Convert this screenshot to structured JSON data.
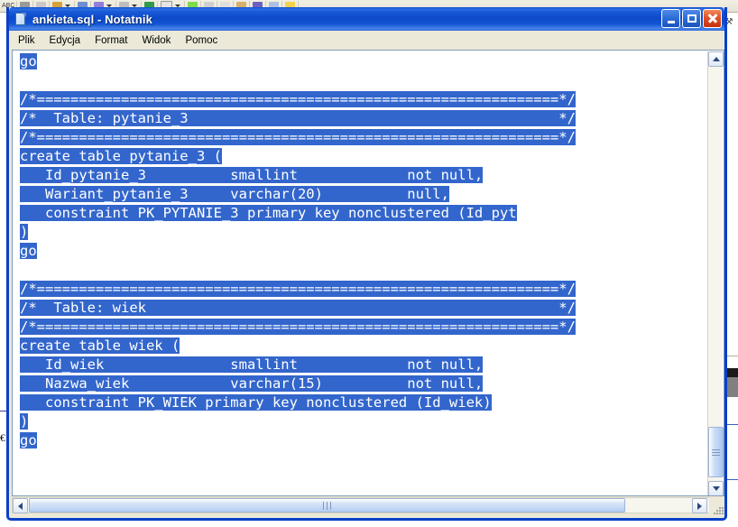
{
  "window": {
    "title": "ankieta.sql - Notatnik",
    "icon": "notepad-document-icon",
    "controls": {
      "minimize": "Minimalizuj",
      "maximize": "Maksymalizuj",
      "close": "Zamknij"
    }
  },
  "menu": {
    "items": [
      {
        "label": "Plik"
      },
      {
        "label": "Edycja"
      },
      {
        "label": "Format"
      },
      {
        "label": "Widok"
      },
      {
        "label": "Pomoc"
      }
    ]
  },
  "editor": {
    "selection_color": "#3366cc",
    "selection_text_color": "#ffffff",
    "background_color": "#ffffff",
    "lines": [
      {
        "text": "go",
        "selected": true
      },
      {
        "text": "",
        "selected": false
      },
      {
        "text": "/*==============================================================*/",
        "selected": true
      },
      {
        "text": "/*  Table: pytanie_3                                            */",
        "selected": true
      },
      {
        "text": "/*==============================================================*/",
        "selected": true
      },
      {
        "text": "create table pytanie_3 (",
        "selected": true
      },
      {
        "text": "   Id_pytanie_3          smallint             not null,",
        "selected": true
      },
      {
        "text": "   Wariant_pytanie_3     varchar(20)          null,",
        "selected": true
      },
      {
        "text": "   constraint PK_PYTANIE_3 primary key nonclustered (Id_pyt",
        "selected": true
      },
      {
        "text": ")",
        "selected": true
      },
      {
        "text": "go",
        "selected": true
      },
      {
        "text": "",
        "selected": false
      },
      {
        "text": "/*==============================================================*/",
        "selected": true
      },
      {
        "text": "/*  Table: wiek                                                 */",
        "selected": true
      },
      {
        "text": "/*==============================================================*/",
        "selected": true
      },
      {
        "text": "create table wiek (",
        "selected": true
      },
      {
        "text": "   Id_wiek               smallint             not null,",
        "selected": true
      },
      {
        "text": "   Nazwa_wiek            varchar(15)          not null,",
        "selected": true
      },
      {
        "text": "   constraint PK_WIEK primary key nonclustered (Id_wiek)",
        "selected": true
      },
      {
        "text": ")",
        "selected": true
      },
      {
        "text": "go",
        "selected": true
      }
    ]
  },
  "scrollbars": {
    "vertical": {
      "up_arrow": "scroll-up",
      "down_arrow": "scroll-down",
      "thumb": "vertical-thumb"
    },
    "horizontal": {
      "left_arrow": "scroll-left",
      "right_arrow": "scroll-right",
      "thumb": "horizontal-thumb"
    }
  },
  "background_app": {
    "toolbar_label": "ABC",
    "right_panel_glyph": "⚒"
  }
}
